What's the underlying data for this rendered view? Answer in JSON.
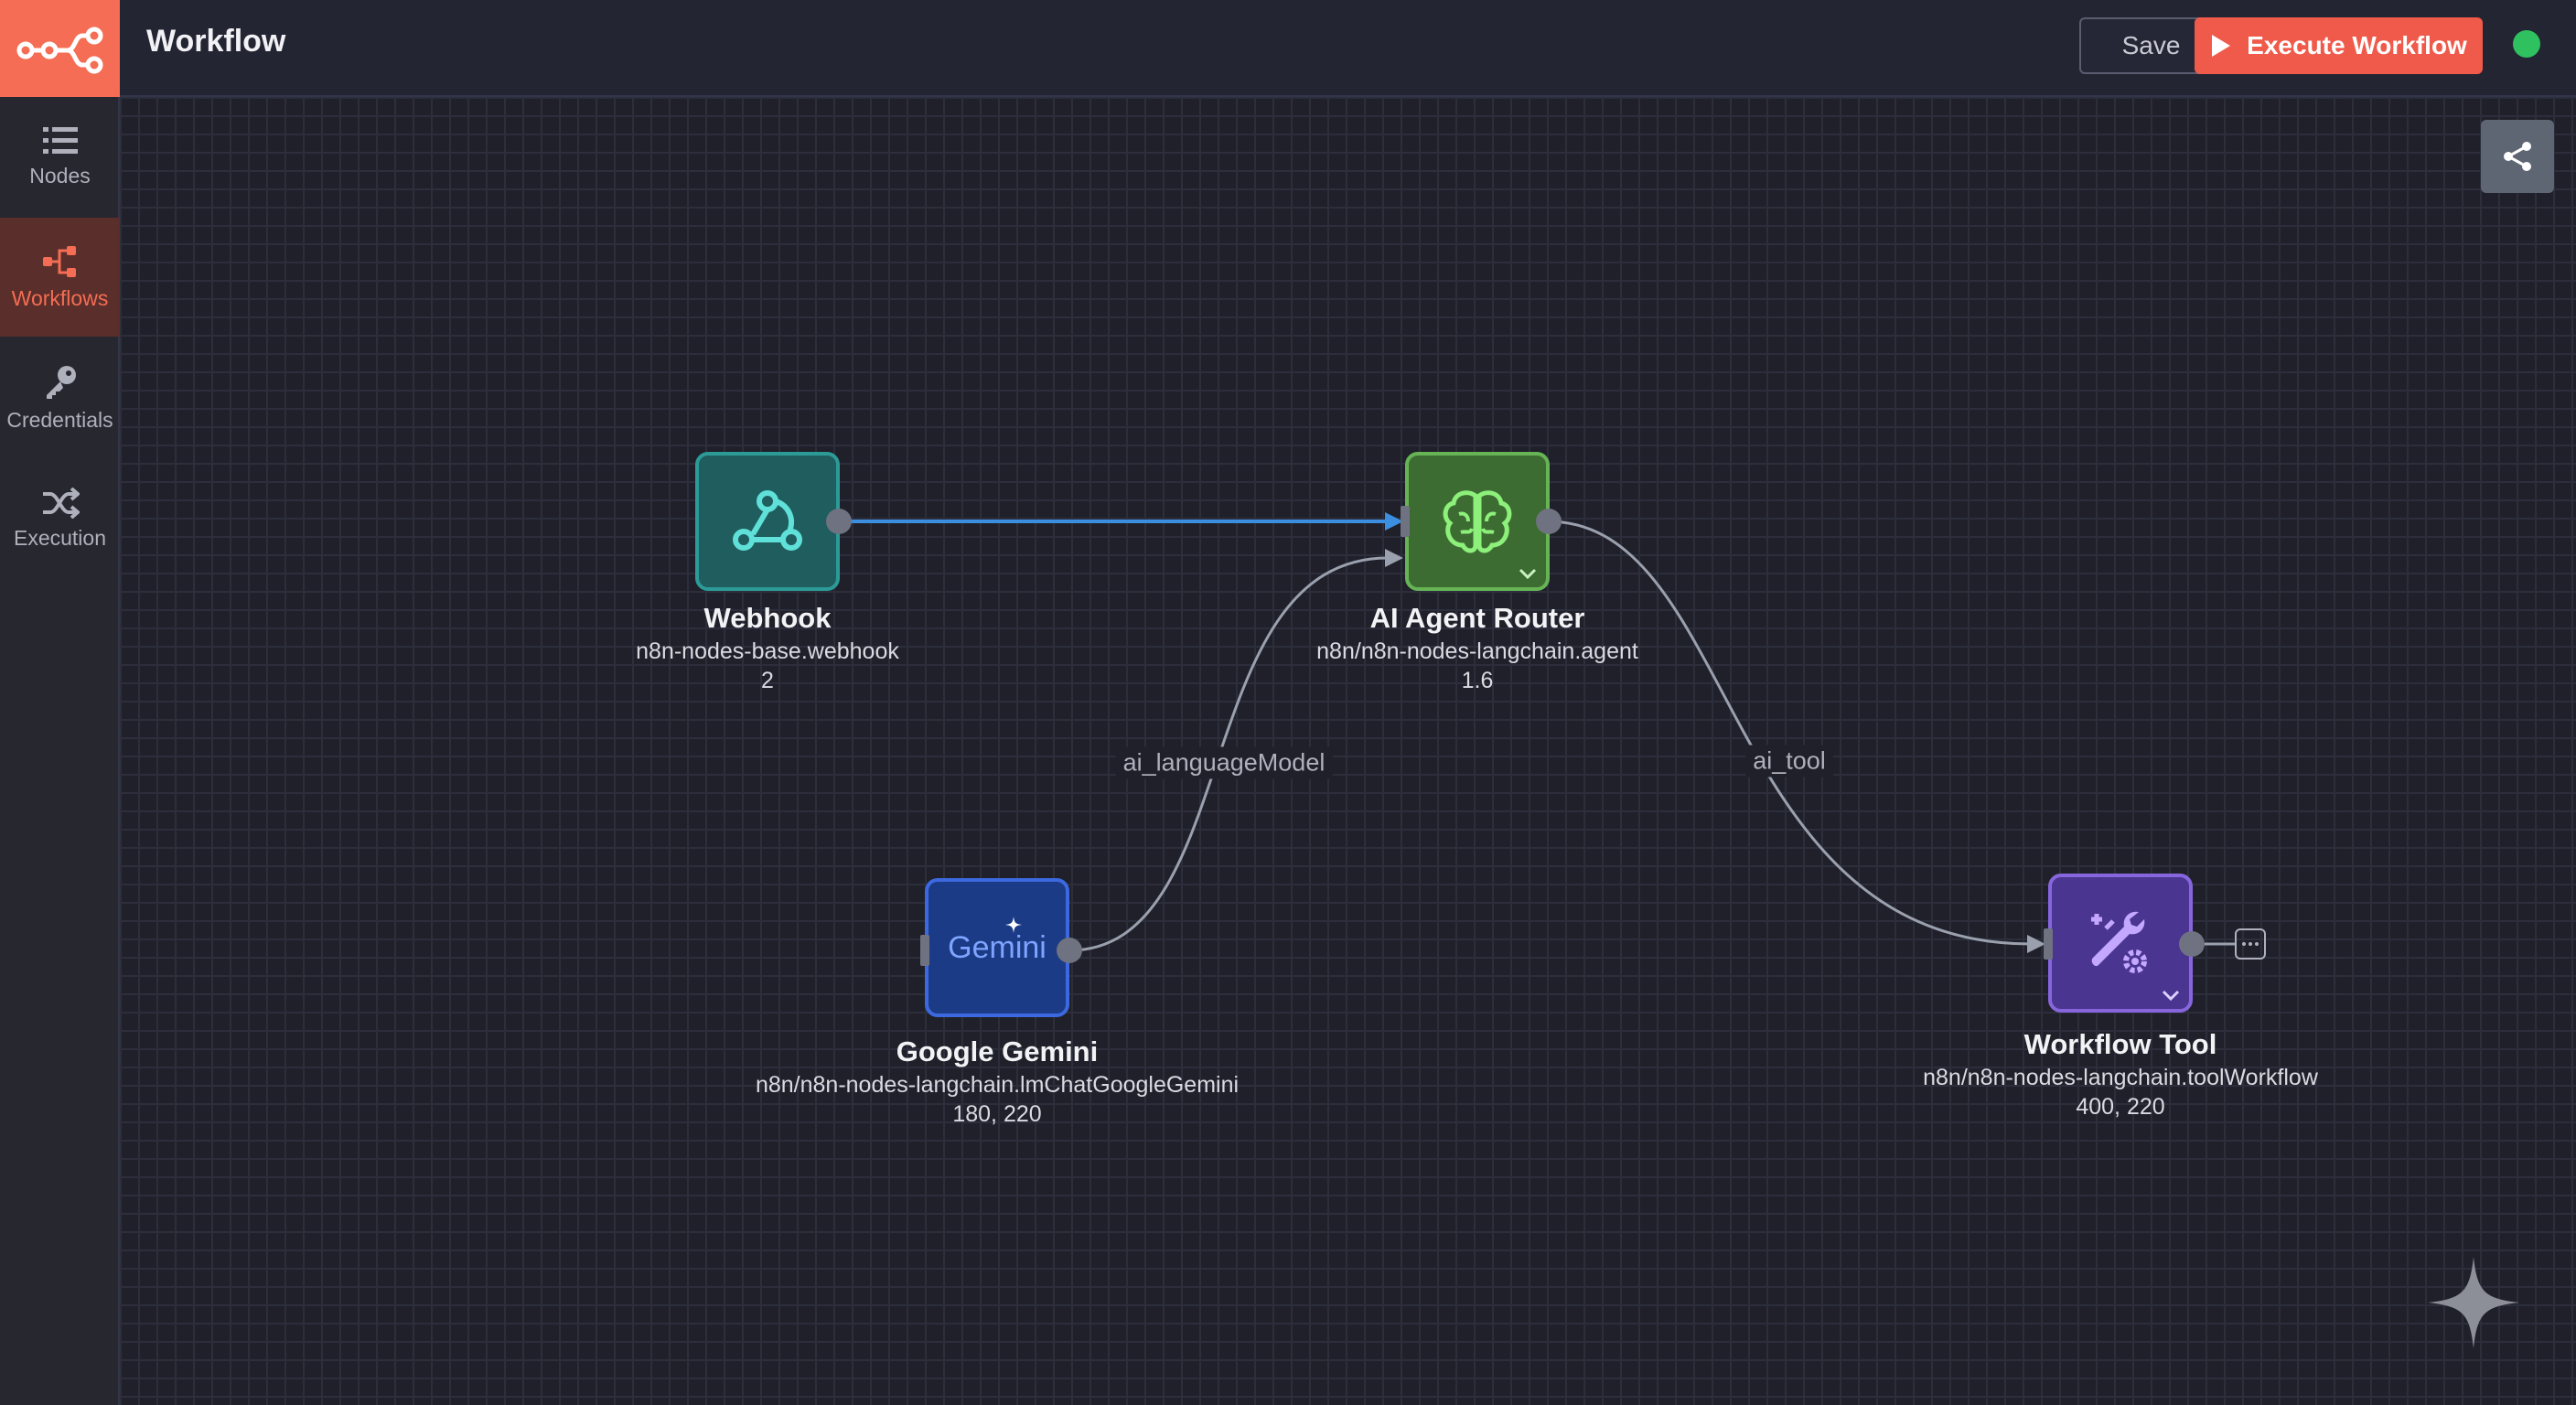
{
  "header": {
    "title": "Workflow",
    "save_label": "Save",
    "execute_label": "Execute Workflow",
    "status_color": "#2fc05f"
  },
  "sidebar": {
    "items": [
      {
        "label": "Nodes",
        "icon": "list-icon",
        "active": false
      },
      {
        "label": "Workflows",
        "icon": "workflow-icon",
        "active": true
      },
      {
        "label": "Credentials",
        "icon": "key-icon",
        "active": false
      },
      {
        "label": "Execution",
        "icon": "shuffle-icon",
        "active": false
      }
    ]
  },
  "nodes": [
    {
      "name": "Webhook",
      "type": "n8n-nodes-base.webhook",
      "version": "2",
      "icon": "webhook-icon",
      "color": "#2c9b98"
    },
    {
      "name": "AI Agent Router",
      "type": "n8n/n8n-nodes-langchain.agent",
      "version": "1.6",
      "icon": "brain-icon",
      "color": "#66b455"
    },
    {
      "name": "Google Gemini",
      "type": "n8n/n8n-nodes-langchain.lmChatGoogleGemini",
      "version": "180, 220",
      "icon": "gemini-logo",
      "logo_text": "Gemini",
      "color": "#3c69e0"
    },
    {
      "name": "Workflow Tool",
      "type": "n8n/n8n-nodes-langchain.toolWorkflow",
      "version": "400, 220",
      "icon": "wrench-gear-icon",
      "color": "#8766dd"
    }
  ],
  "connections": [
    {
      "from": "Webhook",
      "to": "AI Agent Router",
      "label": ""
    },
    {
      "from": "Google Gemini",
      "to": "AI Agent Router",
      "label": "ai_languageModel"
    },
    {
      "from": "AI Agent Router",
      "to": "Workflow Tool",
      "label": "ai_tool"
    }
  ],
  "colors": {
    "accent": "#f46d54",
    "execute": "#f05a4a",
    "main_edge": "#3b8fe0",
    "ai_edge": "#9aa0ad"
  }
}
